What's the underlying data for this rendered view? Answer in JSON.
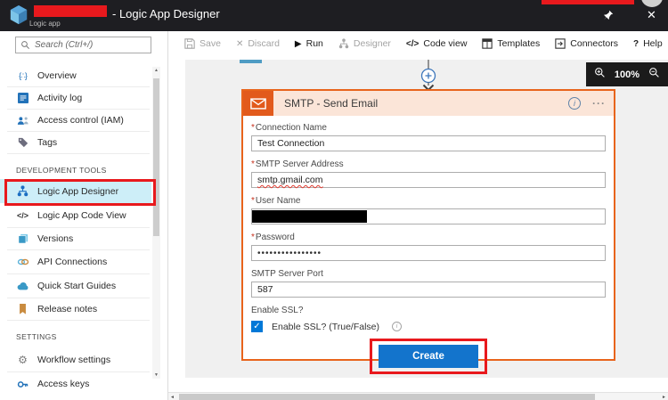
{
  "titlebar": {
    "title_suffix": "- Logic App Designer",
    "app_type": "Logic app"
  },
  "toolbar": {
    "buttons": [
      {
        "label": "Save",
        "state": "disabled"
      },
      {
        "label": "Discard",
        "state": "disabled"
      },
      {
        "label": "Run",
        "state": "enabled"
      },
      {
        "label": "Designer",
        "state": "disabled"
      },
      {
        "label": "Code view",
        "state": "enabled"
      },
      {
        "label": "Templates",
        "state": "enabled"
      },
      {
        "label": "Connectors",
        "state": "enabled"
      },
      {
        "label": "Help",
        "state": "enabled"
      }
    ]
  },
  "sidebar": {
    "search_placeholder": "Search (Ctrl+/)",
    "general_items": [
      "Overview",
      "Activity log",
      "Access control (IAM)",
      "Tags"
    ],
    "development_tools_header": "DEVELOPMENT TOOLS",
    "development_items": [
      "Logic App Designer",
      "Logic App Code View",
      "Versions",
      "API Connections",
      "Quick Start Guides",
      "Release notes"
    ],
    "settings_header": "SETTINGS",
    "settings_items": [
      "Workflow settings",
      "Access keys"
    ],
    "selected_item": "Logic App Designer"
  },
  "canvas": {
    "zoom_level": "100%"
  },
  "smtp_card": {
    "title": "SMTP - Send Email",
    "required_marker": "*",
    "fields": [
      {
        "label": "Connection Name",
        "required": true,
        "value": "Test Connection"
      },
      {
        "label": "SMTP Server Address",
        "required": true,
        "value": "smtp.gmail.com",
        "spellcheck_underline": true
      },
      {
        "label": "User Name",
        "required": true,
        "value": "",
        "redacted": true
      },
      {
        "label": "Password",
        "required": true,
        "value": "••••••••••••••••",
        "masked": true
      },
      {
        "label": "SMTP Server Port",
        "required": false,
        "value": "587"
      }
    ],
    "enable_ssl_label": "Enable SSL?",
    "enable_ssl_checkbox_label": "Enable SSL? (True/False)",
    "enable_ssl_checked": true,
    "create_button_label": "Create"
  },
  "icons": {
    "close": "✕",
    "discard": "✕",
    "run": "▶",
    "code_view": "</>",
    "help": "?",
    "ellipsis": "···",
    "info": "i",
    "checkmark": "✓",
    "gear": "⚙",
    "overview": "{∴}",
    "scroll_up": "▲",
    "scroll_down": "▼",
    "scroll_left": "◄",
    "scroll_right": "►"
  },
  "colors": {
    "annotation_red": "#e8191d",
    "card_border_orange": "#e8641c",
    "card_header_peach": "#fbe5d8",
    "connector_icon_orange": "#e25a1c",
    "create_button_blue": "#1374cc",
    "checkbox_blue": "#0078d7",
    "selected_sidebar_bg": "#cdeef8",
    "titlebar_dark": "#1e1e22",
    "canvas_gray": "#f0f0f0"
  }
}
